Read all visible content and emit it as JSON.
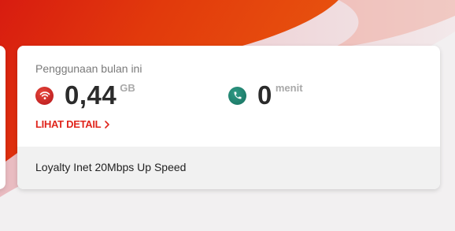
{
  "usage": {
    "title": "Penggunaan bulan ini",
    "data": {
      "value": "0,44",
      "unit": "GB",
      "icon": "wifi-icon"
    },
    "voice": {
      "value": "0",
      "unit": "menit",
      "icon": "phone-icon"
    },
    "detail_link": "LIHAT DETAIL"
  },
  "package": {
    "name": "Loyalty Inet 20Mbps Up Speed"
  },
  "colors": {
    "brand_red": "#e0261d",
    "data_icon_bg": "#c92a25",
    "voice_icon_bg": "#1f7f6c",
    "footer_bg": "#f1f1f1"
  }
}
